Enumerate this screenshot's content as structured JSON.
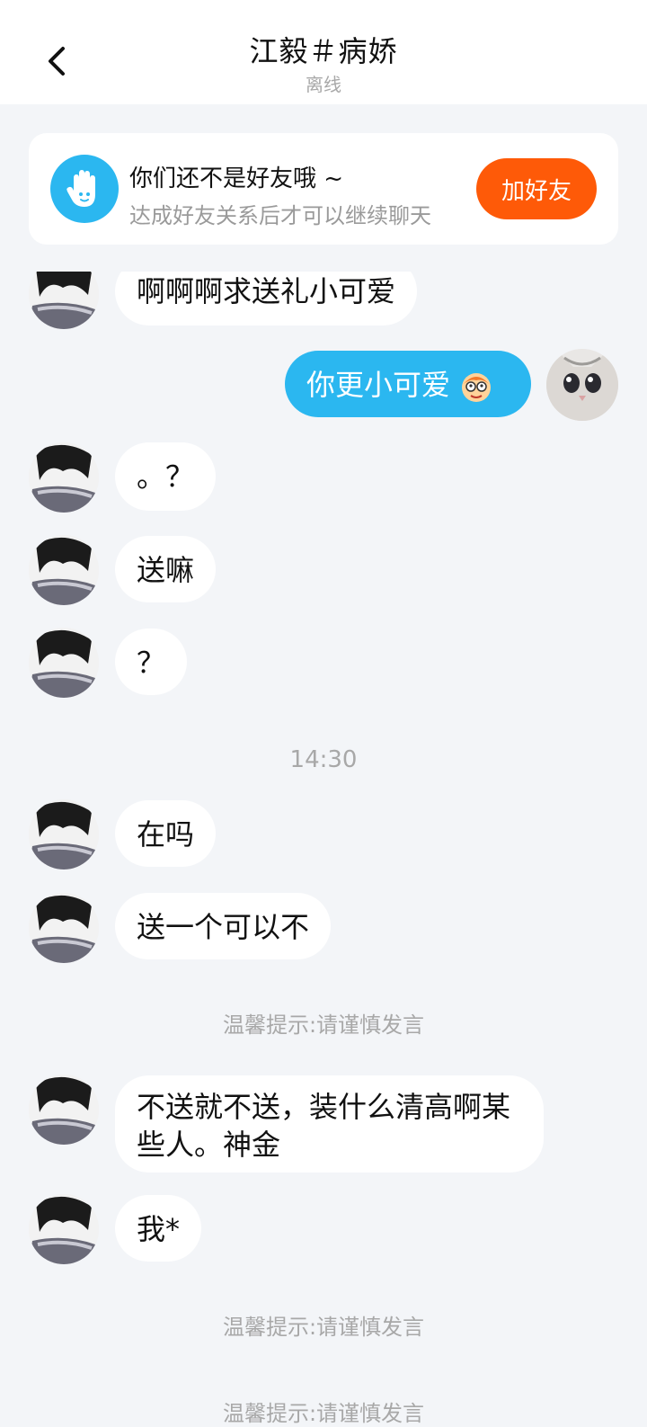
{
  "header": {
    "title": "江毅＃病娇",
    "status": "离线"
  },
  "friend_card": {
    "title": "你们还不是好友哦 ~",
    "subtitle": "达成好友关系后才可以继续聊天",
    "button_label": "加好友"
  },
  "messages": [
    {
      "text": "啊啊啊求送礼小可爱"
    },
    {
      "text": "你更小可爱"
    },
    {
      "text": "。？"
    },
    {
      "text": "送嘛"
    },
    {
      "text": "？"
    },
    {
      "text": "在吗"
    },
    {
      "text": "送一个可以不"
    },
    {
      "text": "不送就不送，装什么清高啊某些人。神金"
    },
    {
      "text": "我*"
    }
  ],
  "timestamp": "14:30",
  "tips": [
    "温馨提示:请谨慎发言",
    "温馨提示:请谨慎发言",
    "温馨提示:请谨慎发言"
  ],
  "colors": {
    "accent": "#2bb7f0",
    "add_button": "#fe5a08",
    "background": "#f3f5f8"
  }
}
